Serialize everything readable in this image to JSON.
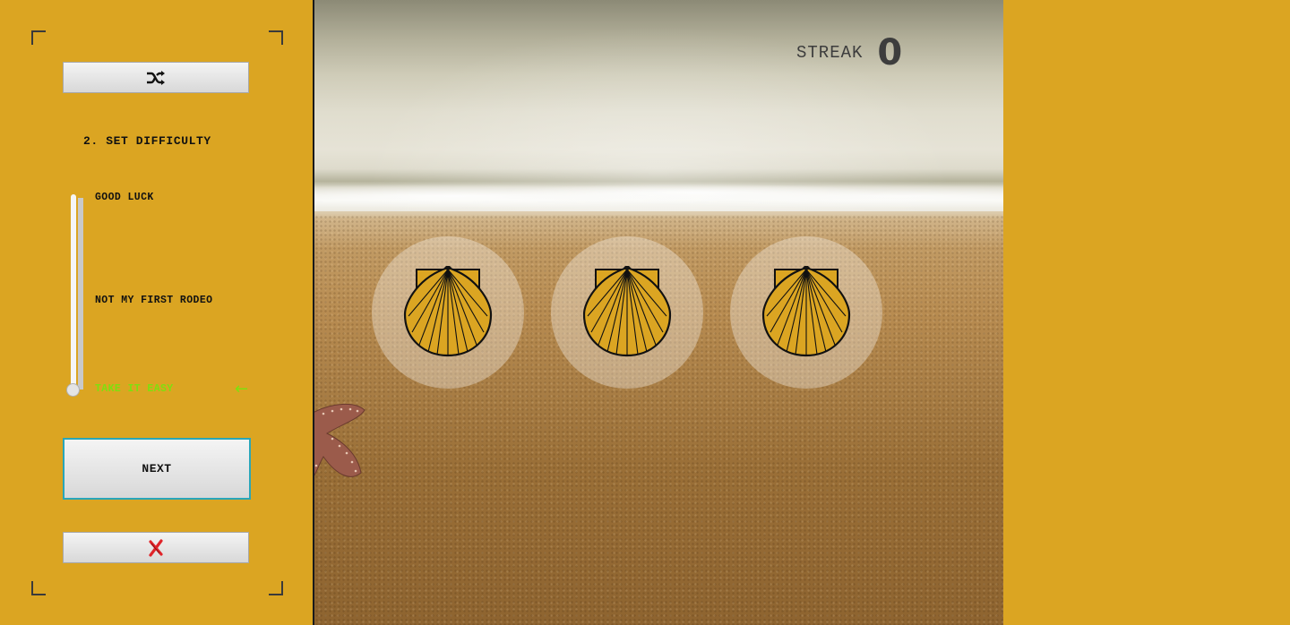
{
  "panel": {
    "step_title": "2. SET DIFFICULTY",
    "difficulty_levels": [
      "GOOD LUCK",
      "NOT MY FIRST RODEO",
      "TAKE IT EASY"
    ],
    "selected_level": "TAKE IT EASY",
    "next_label": "NEXT",
    "shuffle_icon": "shuffle-icon",
    "close_icon": "close-x-icon"
  },
  "game": {
    "streak_label": "STREAK",
    "streak_value": "0",
    "shells": [
      "scallop-shell",
      "scallop-shell",
      "scallop-shell"
    ]
  },
  "colors": {
    "background": "#dba522",
    "active_level": "#7ee00e",
    "shell_fill": "#dba522",
    "next_border": "#2aa6b8",
    "close_icon": "#e0242a"
  }
}
